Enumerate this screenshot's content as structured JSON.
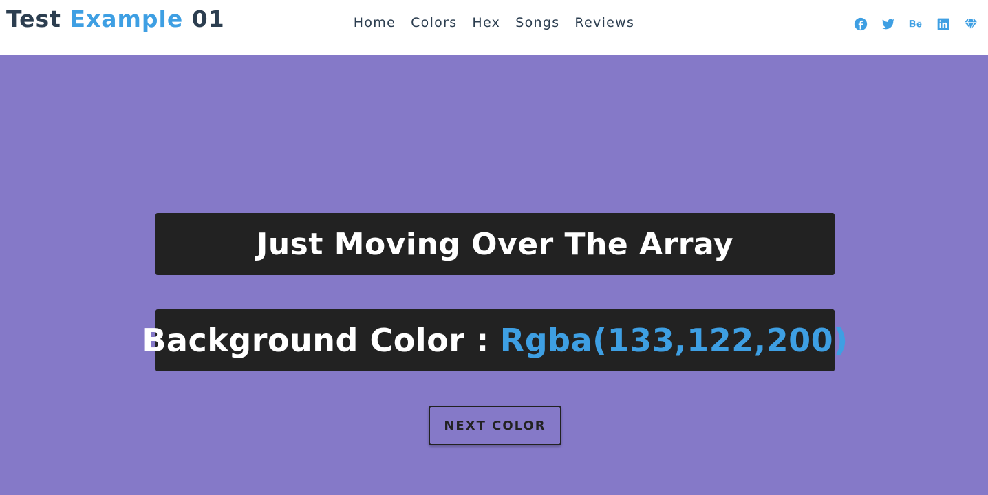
{
  "logo": {
    "part1": "Test",
    "part2": "Example",
    "part3": "01"
  },
  "nav": {
    "items": [
      {
        "label": "Home"
      },
      {
        "label": "Colors"
      },
      {
        "label": "Hex"
      },
      {
        "label": "Songs"
      },
      {
        "label": "Reviews"
      }
    ]
  },
  "social": {
    "icons": [
      "facebook-icon",
      "twitter-icon",
      "behance-icon",
      "linkedin-icon",
      "diamond-icon"
    ],
    "color": "#3e9fe3"
  },
  "hero": {
    "background": "#8579c8",
    "heading": "Just Moving Over The Array",
    "color_label": "Background Color :",
    "color_value": "Rgba(133,122,200)",
    "button_label": "NEXT COLOR"
  },
  "theme": {
    "dark": "#2c3e50",
    "accent": "#3e9fe3",
    "box": "#222222"
  }
}
